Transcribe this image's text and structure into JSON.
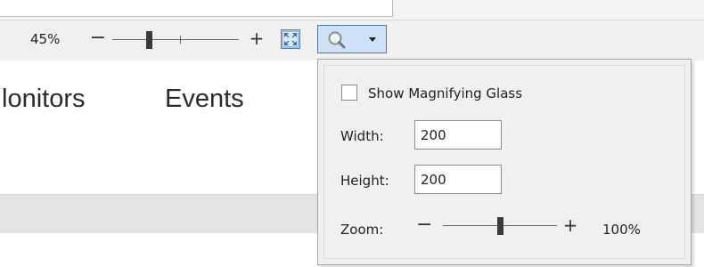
{
  "toolbar": {
    "zoom_percent": "45%",
    "zoom_minus": "−",
    "zoom_plus": "+",
    "zoom_slider_level": 0.28,
    "fit_icon": "fit-to-window-icon",
    "magnifier_icon": "magnifying-glass-icon",
    "dropdown_icon": "chevron-down-icon"
  },
  "tabs": {
    "monitors": "lonitors",
    "events": "Events"
  },
  "magnifier_popup": {
    "show_label": "Show Magnifying Glass",
    "show_checked": false,
    "width_label": "Width:",
    "width_value": "200",
    "height_label": "Height:",
    "height_value": "200",
    "zoom_label": "Zoom:",
    "zoom_minus": "−",
    "zoom_plus": "+",
    "zoom_percent": "100%",
    "zoom_slider_level": 0.5
  },
  "colors": {
    "accent_border": "#5178ad",
    "accent_fill": "#cfe1f7",
    "toolbar_bg": "#f0f0f0",
    "popup_bg": "#f0f0f0"
  }
}
